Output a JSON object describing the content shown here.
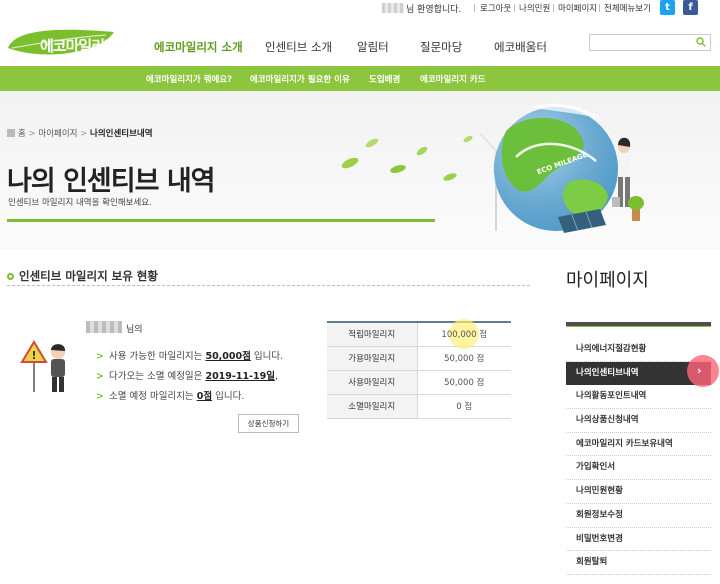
{
  "topbar": {
    "welcome": "님 환영합니다.",
    "links": [
      "로그아웃",
      "나의민원",
      "마이페이지",
      "전체메뉴보기"
    ]
  },
  "header": {
    "logo_text": "에코마일리지",
    "nav": [
      "에코마일리지 소개",
      "인센티브 소개",
      "알림터",
      "질문마당",
      "에코배움터"
    ],
    "search_placeholder": ""
  },
  "subnav": [
    "에코마일리지가 뭐에요?",
    "에코마일리지가 필요한 이유",
    "도입배경",
    "에코마일리지 카드"
  ],
  "banner": {
    "breadcrumb": [
      "홈",
      "마이페이지",
      "나의인센티브내역"
    ],
    "title": "나의 인센티브 내역",
    "subtitle": "인센티브 마일리지 내역을 확인해보세요.",
    "globe_text": "ECO MILEAGE"
  },
  "section": {
    "heading": "인센티브 마일리지 보유 현황"
  },
  "user": {
    "suffix": "님의",
    "lines": [
      {
        "pre": "사용 가능한 마일리지는",
        "em": "50,000점",
        "post": "입니다."
      },
      {
        "pre": "다가오는 소멸 예정일은",
        "em": "2019-11-19일",
        "post": ","
      },
      {
        "pre": "소멸 예정 마일리지는",
        "em": "0점",
        "post": "입니다."
      }
    ],
    "product_button": "상품신청하기"
  },
  "mileage_table": [
    {
      "label": "적립마일리지",
      "value": "100,000 점"
    },
    {
      "label": "가용마일리지",
      "value": "50,000 점"
    },
    {
      "label": "사용마일리지",
      "value": "50,000 점"
    },
    {
      "label": "소멸마일리지",
      "value": "0 점"
    }
  ],
  "sidebar": {
    "title": "마이페이지",
    "items": [
      "나의에너지절감현황",
      "나의인센티브내역",
      "나의활동포인트내역",
      "나의상품신청내역",
      "에코마일리지 카드보유내역",
      "가입확인서",
      "나의민원현황",
      "회원정보수정",
      "비밀번호변경",
      "회원탈퇴"
    ],
    "active_index": 1
  },
  "colors": {
    "brand_green": "#8cc63f",
    "nav_active": "#5f9e1e"
  }
}
